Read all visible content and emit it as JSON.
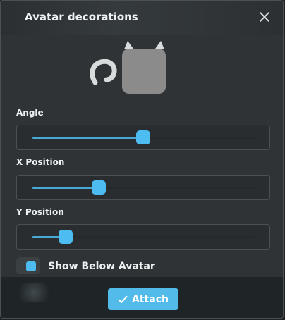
{
  "dialog": {
    "title": "Avatar decorations",
    "close_icon": "close-icon"
  },
  "preview": {
    "decoration_icon": "cat-tail-decoration-icon",
    "avatar_color": "#8b8b8b"
  },
  "controls": {
    "angle": {
      "label": "Angle",
      "value_percent": 50
    },
    "x_position": {
      "label": "X Position",
      "value_percent": 30
    },
    "y_position": {
      "label": "Y Position",
      "value_percent": 15
    },
    "show_below_avatar": {
      "label": "Show Below Avatar",
      "enabled": true
    }
  },
  "footer": {
    "attach_label": "Attach",
    "attach_icon": "check-icon"
  },
  "colors": {
    "accent": "#4dbcf0",
    "button": "#53bbe9"
  }
}
